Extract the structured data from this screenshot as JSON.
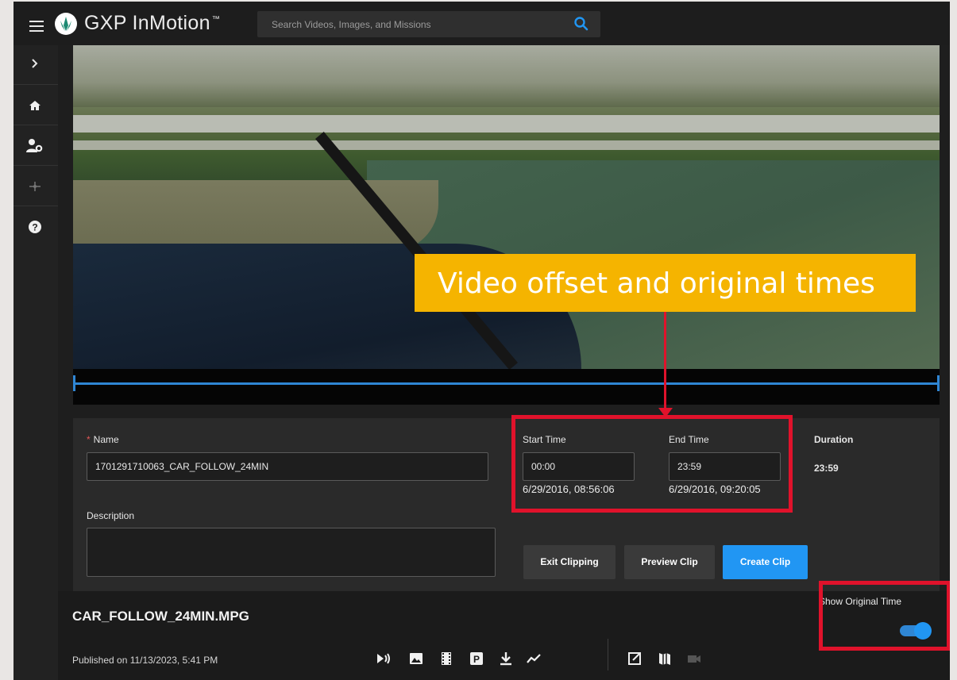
{
  "header": {
    "menu_icon": "hamburger-icon",
    "logo_icon": "gxp-logo-icon",
    "brand": "GXP InMotion",
    "brand_tm": "™",
    "search_placeholder": "Search Videos, Images, and Missions",
    "search_icon": "search-icon",
    "accent_color": "#2196f3"
  },
  "sidebar": {
    "items": [
      {
        "icon": "chevron-right-icon"
      },
      {
        "icon": "home-icon"
      },
      {
        "icon": "user-settings-icon"
      },
      {
        "icon": "network-icon"
      },
      {
        "icon": "help-icon"
      }
    ]
  },
  "clip_form": {
    "name_label": "Name",
    "name_required": "*",
    "name_value": "1701291710063_CAR_FOLLOW_24MIN",
    "description_label": "Description",
    "description_value": "",
    "start_time_label": "Start Time",
    "start_time_value": "00:00",
    "start_original": "6/29/2016, 08:56:06",
    "end_time_label": "End Time",
    "end_time_value": "23:59",
    "end_original": "6/29/2016, 09:20:05",
    "duration_label": "Duration",
    "duration_value": "23:59",
    "exit_button": "Exit Clipping",
    "preview_button": "Preview Clip",
    "create_button": "Create Clip"
  },
  "video_info": {
    "filename": "CAR_FOLLOW_24MIN.MPG",
    "published": "Published on 11/13/2023, 5:41 PM",
    "show_original_label": "Show Original Time",
    "show_original_on": true,
    "toolbar_icons": [
      "play-audio-icon",
      "image-icon",
      "film-icon",
      "parking-icon",
      "download-icon",
      "chart-line-icon",
      "open-external-icon",
      "map-icon",
      "video-camera-icon"
    ]
  },
  "annotation": {
    "callout_text": "Video offset and original times",
    "callout_color": "#f5b400",
    "highlight_color": "#e0122b"
  }
}
